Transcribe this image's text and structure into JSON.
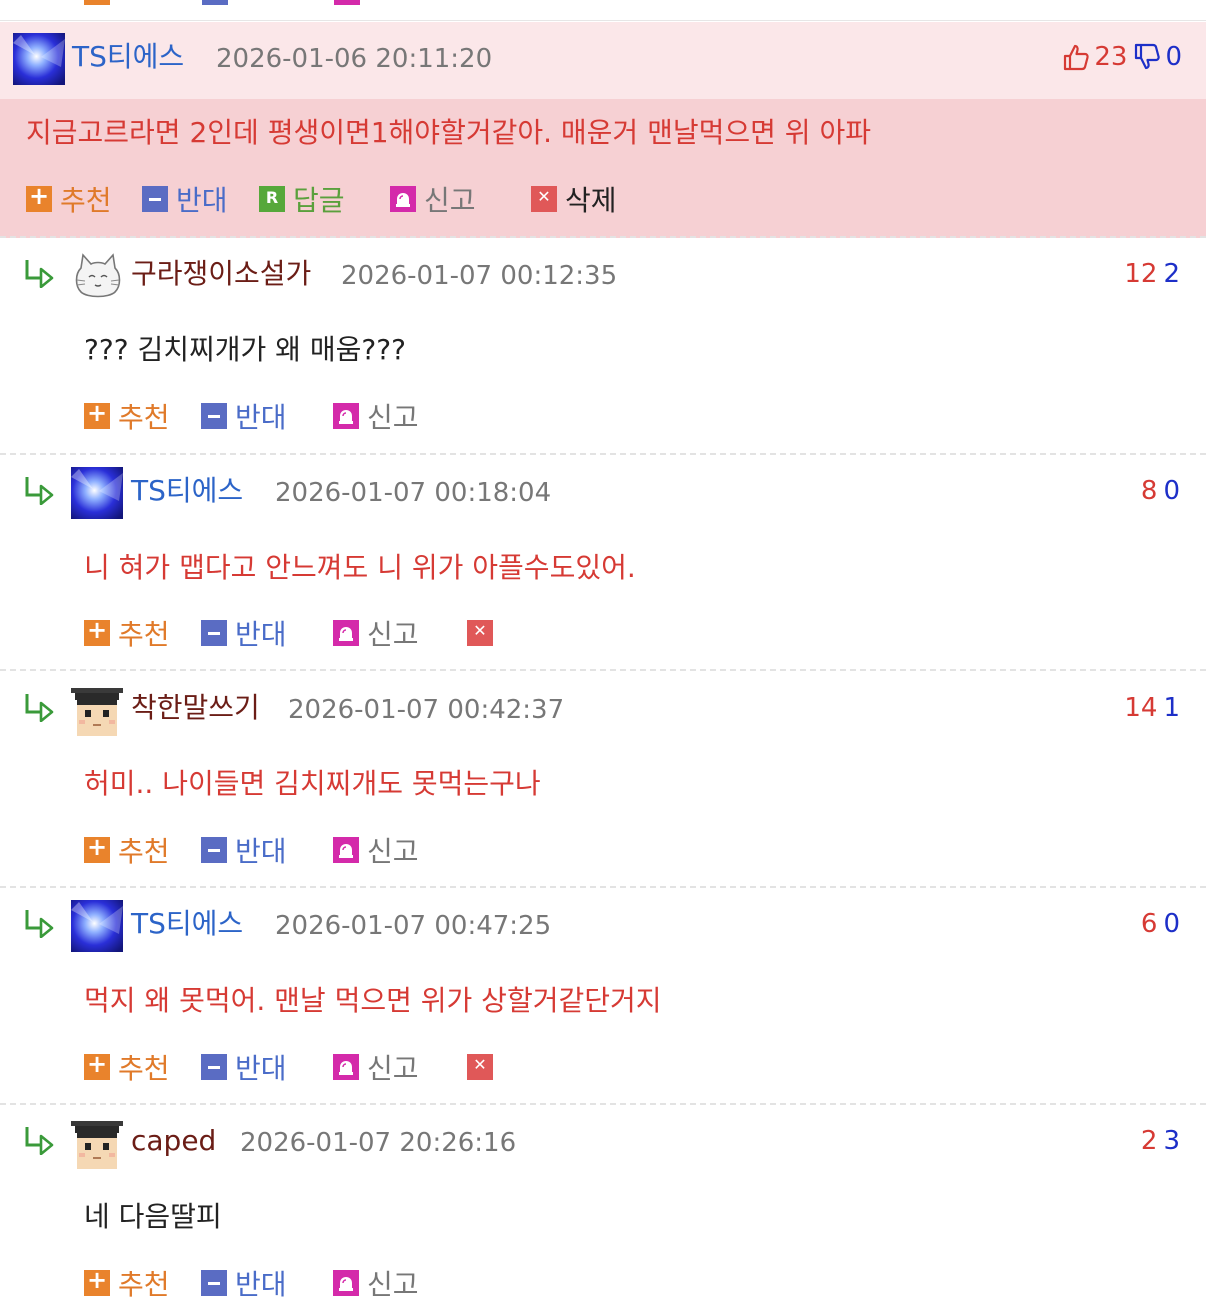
{
  "main": {
    "nickname": "TS티에스",
    "date": "2026-01-06 20:11:20",
    "up": "23",
    "down": "0",
    "message": "지금고르라면 2인데 평생이면1해야할거같아. 매운거 맨날먹으면 위 아파",
    "actions": {
      "recommend": "추천",
      "oppose": "반대",
      "reply": "답글",
      "report": "신고",
      "delete": "삭제"
    }
  },
  "replies": [
    {
      "nickname": "구라쟁이소설가",
      "date": "2026-01-07 00:12:35",
      "up": "12",
      "down": "2",
      "message": "??? 김치찌개가 왜 매움???",
      "recommend": "추천",
      "oppose": "반대",
      "report": "신고"
    },
    {
      "nickname": "TS티에스",
      "date": "2026-01-07 00:18:04",
      "up": "8",
      "down": "0",
      "message": "니 혀가 맵다고 안느껴도 니 위가 아플수도있어.",
      "recommend": "추천",
      "oppose": "반대",
      "report": "신고"
    },
    {
      "nickname": "착한말쓰기",
      "date": "2026-01-07 00:42:37",
      "up": "14",
      "down": "1",
      "message": "허미.. 나이들면 김치찌개도 못먹는구나",
      "recommend": "추천",
      "oppose": "반대",
      "report": "신고"
    },
    {
      "nickname": "TS티에스",
      "date": "2026-01-07 00:47:25",
      "up": "6",
      "down": "0",
      "message": "먹지 왜 못먹어. 맨날 먹으면 위가 상할거같단거지",
      "recommend": "추천",
      "oppose": "반대",
      "report": "신고"
    },
    {
      "nickname": "caped",
      "date": "2026-01-07 20:26:16",
      "up": "2",
      "down": "3",
      "message": "네 다음딸피",
      "recommend": "추천",
      "oppose": "반대",
      "report": "신고"
    }
  ],
  "colors": {
    "accent_red": "#d63a34",
    "nick_blue": "#2c64c8",
    "nick_dark": "#6b1d16",
    "main_bg": "#f6d0d3"
  }
}
